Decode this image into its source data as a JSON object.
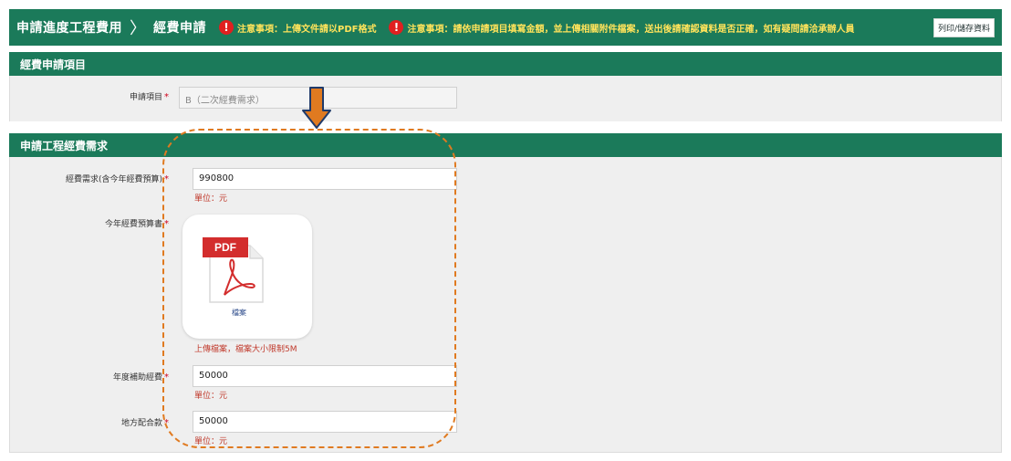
{
  "header": {
    "breadcrumb_1": "申請進度工程費用",
    "breadcrumb_sep": "〉",
    "breadcrumb_2": "經費申請",
    "note_1_icon": "!",
    "note_1": "注意事項：上傳文件請以PDF格式",
    "note_2_icon": "!",
    "note_2": "注意事項：請依申請項目填寫金額，並上傳相關附件檔案，送出後請確認資料是否正確，如有疑問請洽承辦人員",
    "print_button": "列印/儲存資料"
  },
  "section_1": {
    "title": "經費申請項目",
    "fields": [
      {
        "label": "申請項目",
        "required": "*",
        "value": "B（二次經費需求）"
      }
    ]
  },
  "section_2": {
    "title": "申請工程經費需求",
    "fields": [
      {
        "label": "經費需求(含今年經費預算)",
        "required": "*",
        "value": "990800",
        "hint": "單位：元"
      },
      {
        "label": "今年經費預算書",
        "required": "*",
        "file_type": "PDF",
        "file_caption": "檔案",
        "hint": "上傳檔案，檔案大小限制5M"
      },
      {
        "label": "年度補助經費",
        "required": "*",
        "value": "50000",
        "hint": "單位：元"
      },
      {
        "label": "地方配合款",
        "required": "*",
        "value": "50000",
        "hint": "單位：元"
      }
    ]
  },
  "annotations": {
    "arrow_color": "#e07a20",
    "arrow_outline": "#1f3a6a",
    "highlight_color": "#e07a20"
  },
  "colors": {
    "header_green": "#1b7a5a",
    "alert_red": "#e02020",
    "required_red": "#d0021b",
    "panel_bg": "#efefef"
  }
}
